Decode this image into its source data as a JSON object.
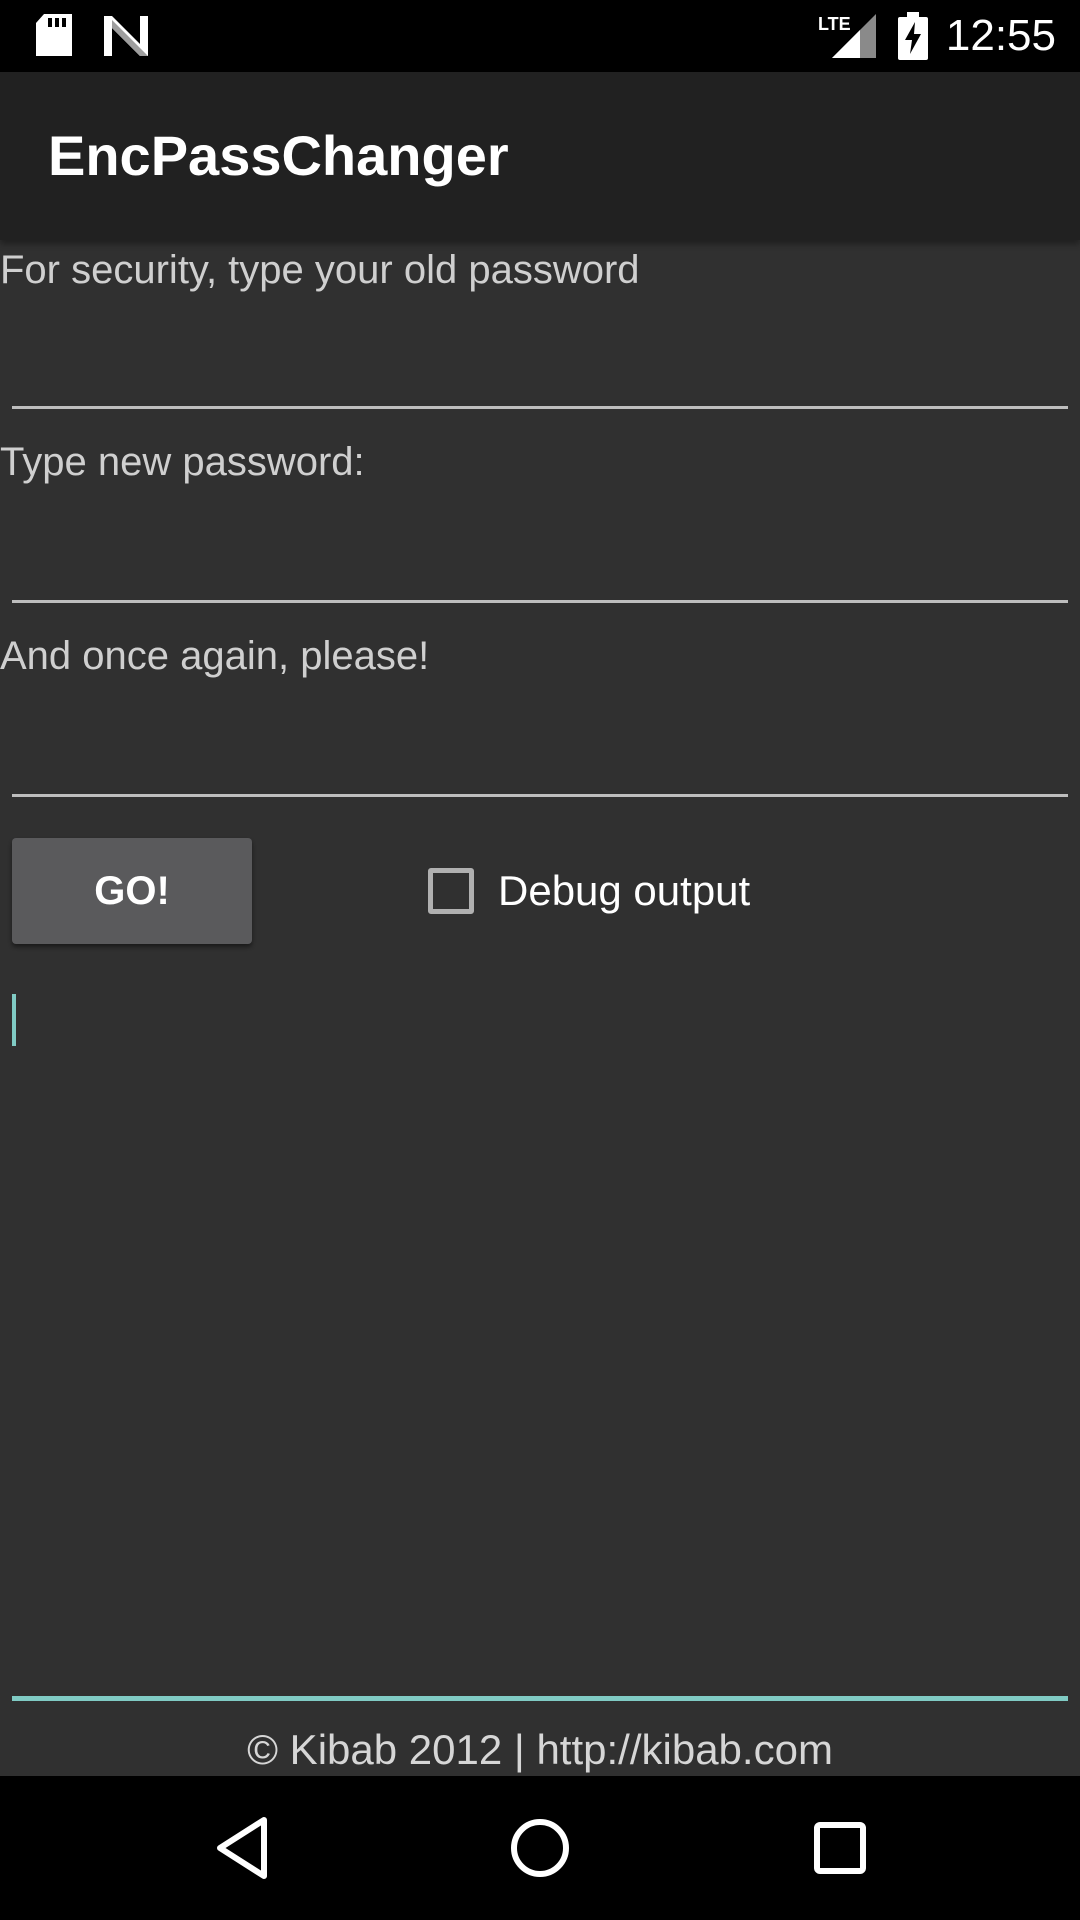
{
  "status_bar": {
    "time": "12:55",
    "icons": [
      "sd-card-icon",
      "n-logo-icon",
      "lte-signal-icon",
      "battery-charging-icon"
    ]
  },
  "app_bar": {
    "title": "EncPassChanger"
  },
  "form": {
    "old_password_label": "For security, type your old password",
    "old_password_value": "",
    "new_password_label": "Type new password:",
    "new_password_value": "",
    "confirm_password_label": "And once again, please!",
    "confirm_password_value": "",
    "go_button_label": "GO!",
    "debug_checkbox_label": "Debug output",
    "debug_checked": false,
    "output_text": ""
  },
  "footer": {
    "text": "© Kibab 2012 | http://kibab.com"
  },
  "nav_bar": {
    "icons": [
      "back-icon",
      "home-icon",
      "recents-icon"
    ]
  },
  "colors": {
    "background": "#303030",
    "app_bar": "#212121",
    "accent": "#80cbc4",
    "button": "#5a5a5c"
  }
}
